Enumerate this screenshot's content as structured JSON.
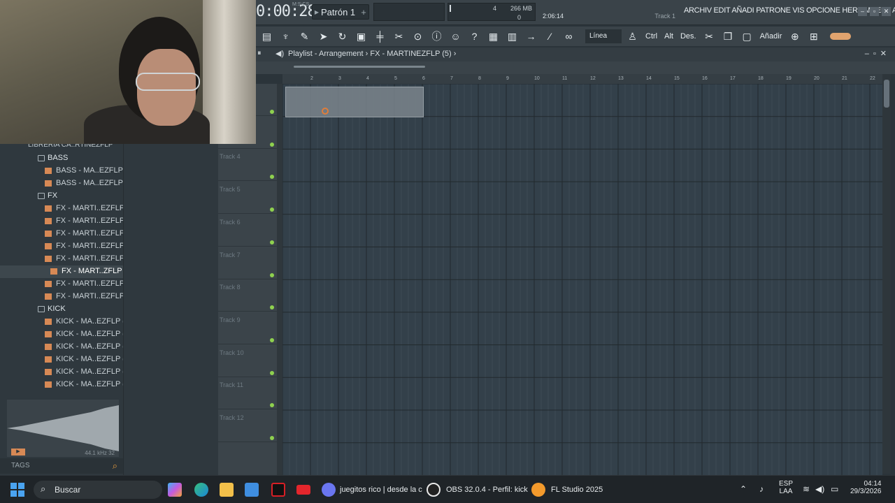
{
  "topbar": {
    "time": "0:00:28",
    "time_unit": "M:S:CS",
    "pattern": "Patrón 1",
    "pattern_add": "+",
    "cpu_value": "4",
    "memory": "266 MB",
    "voices": "0",
    "hint_time": "2:06:14",
    "hint_track": "Track 1",
    "menu": "ARCHIV EDIT AÑADI PATRONE VIS OPCIONE HERRAMIENT A",
    "win_min": "–",
    "win_max": "▫",
    "win_close": "✕"
  },
  "toolbar": {
    "linea": "Línea",
    "ctrl": "Ctrl",
    "alt": "Alt",
    "des": "Des.",
    "anadir": "Añadir"
  },
  "playlist": {
    "title": "Playlist - Arrangement",
    "breadcrumb": "FX - MARTINEZFLP (5)",
    "ruler": [
      "2",
      "3",
      "4",
      "5",
      "6",
      "7",
      "8",
      "9",
      "10",
      "11",
      "12",
      "13",
      "14",
      "15",
      "16",
      "17",
      "18",
      "19",
      "20",
      "21",
      "22"
    ],
    "tracks": [
      "",
      "Track 3",
      "Track 4",
      "Track 5",
      "Track 6",
      "Track 7",
      "Track 8",
      "Track 9",
      "Track 10",
      "Track 11",
      "Track 12"
    ]
  },
  "browser": {
    "header": "LIBRERÍA CA..RTINEZFLP",
    "items": [
      {
        "type": "folder",
        "label": "BASS"
      },
      {
        "type": "file",
        "label": "BASS - MA..EZFLP (4)"
      },
      {
        "type": "file",
        "label": "BASS - MA..EZFLP (5)"
      },
      {
        "type": "folder",
        "label": "FX"
      },
      {
        "type": "file",
        "label": "FX - MARTI..EZFLP (1)"
      },
      {
        "type": "file",
        "label": "FX - MARTI..EZFLP (1)"
      },
      {
        "type": "file",
        "label": "FX - MARTI..EZFLP (2)"
      },
      {
        "type": "file",
        "label": "FX - MARTI..EZFLP (3)"
      },
      {
        "type": "file",
        "label": "FX - MARTI..EZFLP (4)"
      },
      {
        "type": "file",
        "label": "FX - MART..ZFLP (5)",
        "selected": true
      },
      {
        "type": "file",
        "label": "FX - MARTI..EZFLP (6)"
      },
      {
        "type": "file",
        "label": "FX - MARTI..EZFLP (7)"
      },
      {
        "type": "folder",
        "label": "KICK"
      },
      {
        "type": "file",
        "label": "KICK - MA..EZFLP (1)"
      },
      {
        "type": "file",
        "label": "KICK - MA..EZFLP (2)"
      },
      {
        "type": "file",
        "label": "KICK - MA..EZFLP (3)"
      },
      {
        "type": "file",
        "label": "KICK - MA..EZFLP (4)"
      },
      {
        "type": "file",
        "label": "KICK - MA..EZFLP (5)"
      },
      {
        "type": "file",
        "label": "KICK - MA..EZFLP (6)"
      }
    ],
    "sample_info": "44.1 kHz 32",
    "tags_label": "TAGS"
  },
  "taskbar": {
    "search": "Buscar",
    "discord": "juegitos rico | desde la c",
    "obs": "OBS 32.0.4 - Perfil: kick",
    "fl": "FL Studio 2025",
    "lang1": "ESP",
    "lang2": "LAA",
    "clock_time": "04:14",
    "clock_date": "29/3/2026",
    "discord_badge": "9+"
  }
}
